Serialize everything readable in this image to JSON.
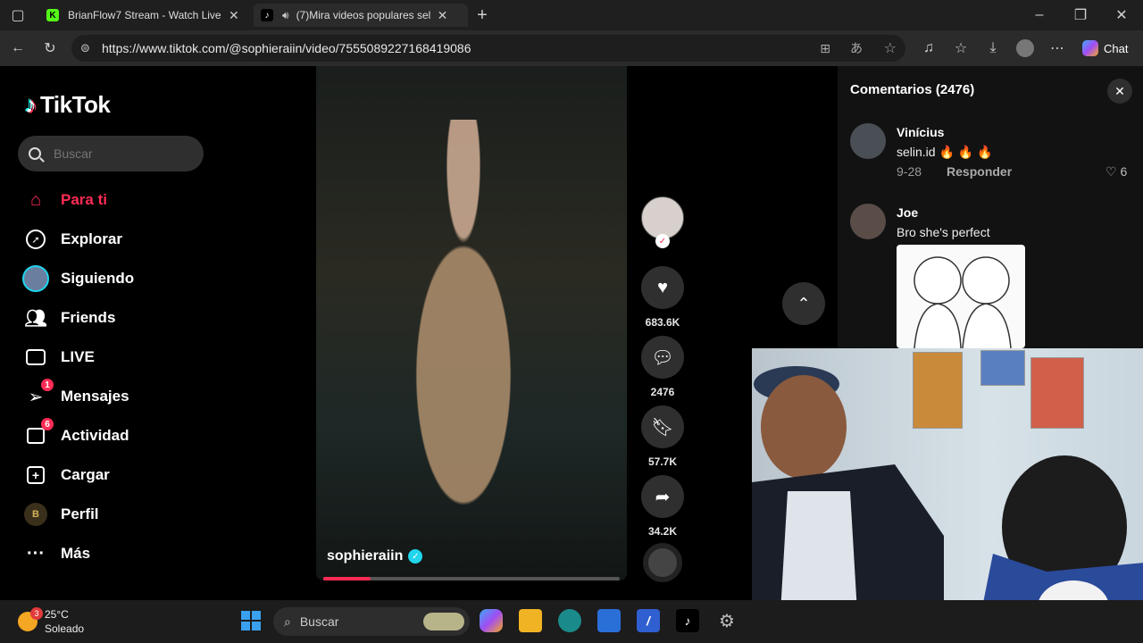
{
  "browser": {
    "tabs": [
      {
        "title": "BrianFlow7 Stream - Watch Live o",
        "favicon": "K"
      },
      {
        "title": "(7)Mira videos populares sele",
        "favicon": "♪"
      }
    ],
    "url": "https://www.tiktok.com/@sophieraiin/video/7555089227168419086",
    "chat_label": "Chat"
  },
  "sidebar": {
    "logo": "TikTok",
    "search_placeholder": "Buscar",
    "items": [
      {
        "label": "Para ti",
        "icon": "home-icon",
        "active": true
      },
      {
        "label": "Explorar",
        "icon": "compass-icon"
      },
      {
        "label": "Siguiendo",
        "icon": "following-avatar-icon"
      },
      {
        "label": "Friends",
        "icon": "friends-icon"
      },
      {
        "label": "LIVE",
        "icon": "live-tv-icon"
      },
      {
        "label": "Mensajes",
        "icon": "messages-icon",
        "badge": "1"
      },
      {
        "label": "Actividad",
        "icon": "activity-icon",
        "badge": "6"
      },
      {
        "label": "Cargar",
        "icon": "upload-icon"
      },
      {
        "label": "Perfil",
        "icon": "profile-avatar-icon"
      },
      {
        "label": "Más",
        "icon": "more-icon"
      }
    ]
  },
  "video": {
    "username": "sophieraiin",
    "progress": 0.16,
    "likes": "683.6K",
    "comments": "2476",
    "saves": "57.7K",
    "shares": "34.2K"
  },
  "comments_panel": {
    "title": "Comentarios (2476)",
    "items": [
      {
        "name": "Vinícius",
        "text": "selin.id 🔥 🔥 🔥",
        "date": "9-28",
        "reply": "Responder",
        "likes": "6"
      },
      {
        "name": "Joe",
        "text": "Bro she's perfect"
      }
    ]
  },
  "taskbar": {
    "temp": "25°C",
    "condition": "Soleado",
    "weather_badge": "3",
    "search_placeholder": "Buscar"
  },
  "colors": {
    "accent": "#fe2c55",
    "verified": "#20d5ec"
  }
}
